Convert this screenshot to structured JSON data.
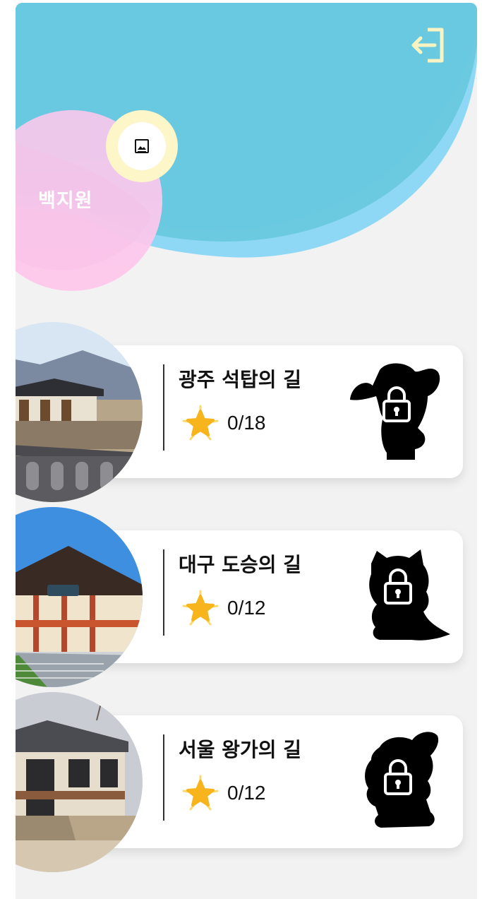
{
  "header": {
    "logout_icon": "logout-icon",
    "gallery_icon": "image-icon",
    "colors": {
      "wave_blue": "#6ccae0",
      "wave_light_blue": "#8fd8f5",
      "profile_pink": "#f8c6ec",
      "gallery_ring": "#fdf6c8"
    }
  },
  "profile": {
    "name": "백지원"
  },
  "courses": [
    {
      "title": "광주 석탑의 길",
      "progress": "0/18",
      "locked": true,
      "star_icon": "star-icon",
      "lock_icon": "lock-icon"
    },
    {
      "title": "대구 도승의 길",
      "progress": "0/12",
      "locked": true,
      "star_icon": "star-icon",
      "lock_icon": "lock-icon"
    },
    {
      "title": "서울 왕가의 길",
      "progress": "0/12",
      "locked": true,
      "star_icon": "star-icon",
      "lock_icon": "lock-icon"
    }
  ]
}
